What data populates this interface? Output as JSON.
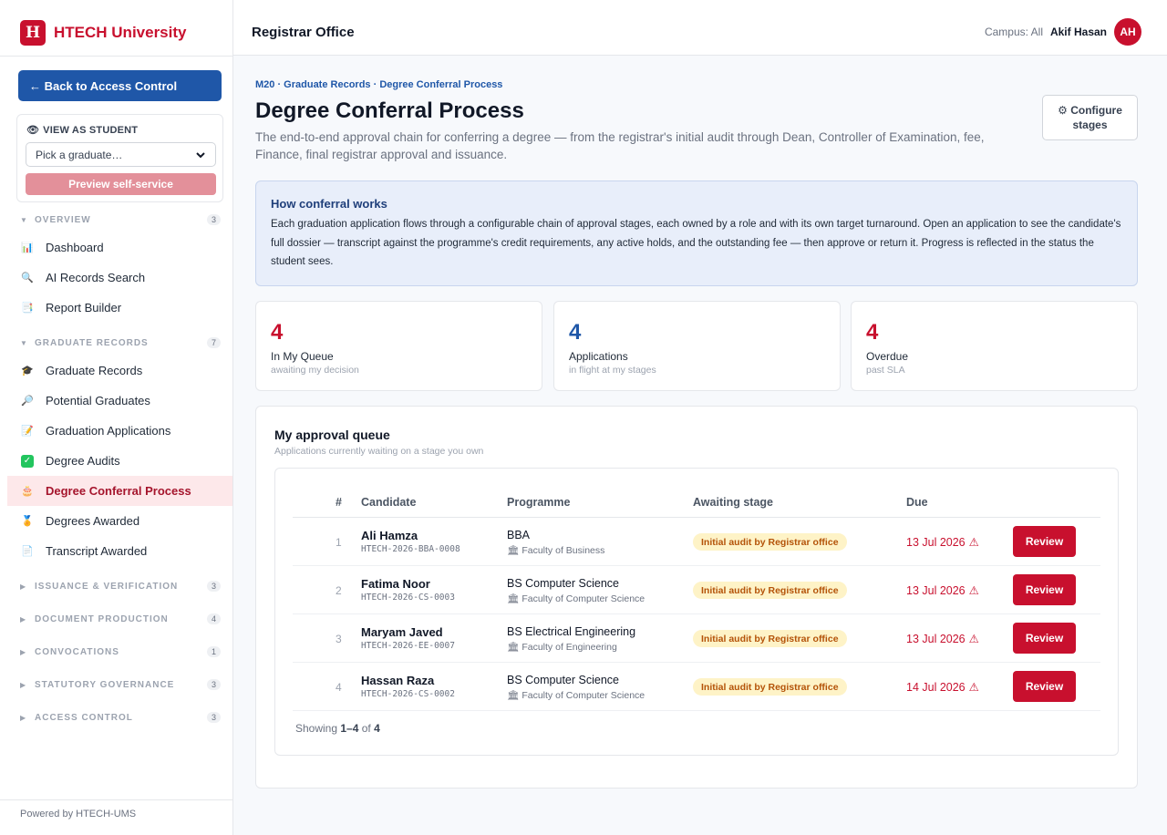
{
  "brand": {
    "logo_letter": "H",
    "name": "HTECH University"
  },
  "sidebar": {
    "back_label": "← Back to Access Control",
    "view_as_student": {
      "title": "VIEW AS STUDENT",
      "select_value": "Pick a graduate…",
      "preview_label": "Preview self-service"
    },
    "sections": [
      {
        "label": "OVERVIEW",
        "count": "3",
        "expanded": true,
        "items": [
          {
            "label": "Dashboard",
            "icon": "bar-chart-icon"
          },
          {
            "label": "AI Records Search",
            "icon": "magnifier-icon"
          },
          {
            "label": "Report Builder",
            "icon": "report-icon"
          }
        ]
      },
      {
        "label": "GRADUATE RECORDS",
        "count": "7",
        "expanded": true,
        "items": [
          {
            "label": "Graduate Records",
            "icon": "grad-cap-icon"
          },
          {
            "label": "Potential Graduates",
            "icon": "search-icon"
          },
          {
            "label": "Graduation Applications",
            "icon": "application-icon"
          },
          {
            "label": "Degree Audits",
            "icon": "check-icon"
          },
          {
            "label": "Degree Conferral Process",
            "icon": "ceremony-icon",
            "active": true
          },
          {
            "label": "Degrees Awarded",
            "icon": "medal-icon"
          },
          {
            "label": "Transcript Awarded",
            "icon": "transcript-icon"
          }
        ]
      },
      {
        "label": "ISSUANCE & VERIFICATION",
        "count": "3",
        "expanded": false
      },
      {
        "label": "DOCUMENT PRODUCTION",
        "count": "4",
        "expanded": false
      },
      {
        "label": "CONVOCATIONS",
        "count": "1",
        "expanded": false
      },
      {
        "label": "STATUTORY GOVERNANCE",
        "count": "3",
        "expanded": false
      },
      {
        "label": "ACCESS CONTROL",
        "count": "3",
        "expanded": false
      }
    ],
    "powered_by": "Powered by HTECH-UMS"
  },
  "topbar": {
    "title": "Registrar Office",
    "campus": "Campus: All",
    "user_name": "Akif Hasan",
    "avatar_initials": "AH"
  },
  "page": {
    "breadcrumb": "M20 · Graduate Records · Degree Conferral Process",
    "title": "Degree Conferral Process",
    "subtitle": "The end-to-end approval chain for conferring a degree — from the registrar's initial audit through Dean, Controller of Examination, fee, Finance, final registrar approval and issuance.",
    "configure_label": "⚙ Configure stages"
  },
  "info": {
    "title": "How conferral works",
    "body": "Each graduation application flows through a configurable chain of approval stages, each owned by a role and with its own target turnaround. Open an application to see the candidate's full dossier — transcript against the programme's credit requirements, any active holds, and the outstanding fee — then approve or return it. Progress is reflected in the status the student sees."
  },
  "stats": [
    {
      "value": "4",
      "label": "In My Queue",
      "sub": "awaiting my decision",
      "color": "#c8102e"
    },
    {
      "value": "4",
      "label": "Applications",
      "sub": "in flight at my stages",
      "color": "#1f57a8"
    },
    {
      "value": "4",
      "label": "Overdue",
      "sub": "past SLA",
      "color": "#c8102e"
    }
  ],
  "queue": {
    "title": "My approval queue",
    "subtitle": "Applications currently waiting on a stage you own",
    "columns": {
      "num": "#",
      "candidate": "Candidate",
      "programme": "Programme",
      "stage": "Awaiting stage",
      "due": "Due"
    },
    "rows": [
      {
        "num": "1",
        "name": "Ali Hamza",
        "id": "HTECH-2026-BBA-0008",
        "programme": "BBA",
        "faculty": "Faculty of Business",
        "stage": "Initial audit by Registrar office",
        "due": "13 Jul 2026",
        "action": "Review"
      },
      {
        "num": "2",
        "name": "Fatima Noor",
        "id": "HTECH-2026-CS-0003",
        "programme": "BS Computer Science",
        "faculty": "Faculty of Computer Science",
        "stage": "Initial audit by Registrar office",
        "due": "13 Jul 2026",
        "action": "Review"
      },
      {
        "num": "3",
        "name": "Maryam Javed",
        "id": "HTECH-2026-EE-0007",
        "programme": "BS Electrical Engineering",
        "faculty": "Faculty of Engineering",
        "stage": "Initial audit by Registrar office",
        "due": "13 Jul 2026",
        "action": "Review"
      },
      {
        "num": "4",
        "name": "Hassan Raza",
        "id": "HTECH-2026-CS-0002",
        "programme": "BS Computer Science",
        "faculty": "Faculty of Computer Science",
        "stage": "Initial audit by Registrar office",
        "due": "14 Jul 2026",
        "action": "Review"
      }
    ],
    "showing": {
      "prefix": "Showing",
      "range": "1–4",
      "of": "of",
      "total": "4"
    }
  },
  "colors": {
    "brand": "#c8102e",
    "primary": "#1f57a8",
    "warning_bg": "#fef3c7",
    "warning_text": "#b45309"
  }
}
